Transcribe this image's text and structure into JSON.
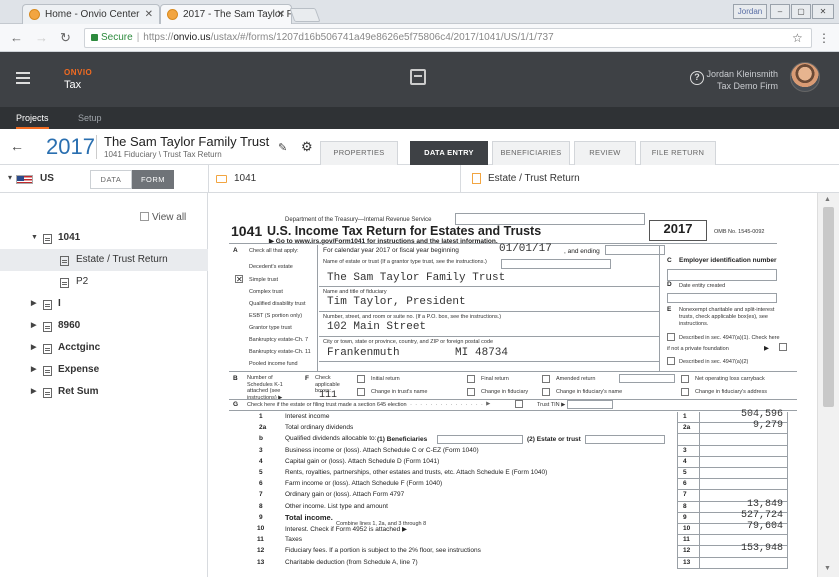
{
  "browser": {
    "tabs": [
      {
        "label": "Home - Onvio Center"
      },
      {
        "label": "2017 - The Sam Taylor F..."
      }
    ],
    "window_user": "Jordan",
    "url": {
      "secure_label": "Secure",
      "scheme": "https://",
      "host": "onvio.us",
      "path": "/ustax/#/forms/1207d16b506741a49e8626e5f75806c4/2017/1041/US/1/1/737"
    }
  },
  "app": {
    "brand": "ONVIO",
    "product": "Tax",
    "user_name": "Jordan Kleinsmith",
    "firm": "Tax Demo Firm",
    "nav": [
      "Projects",
      "Setup"
    ]
  },
  "client": {
    "year": "2017",
    "name": "The Sam Taylor Family Trust",
    "subtitle": "1041 Fiduciary \\ Trust Tax Return",
    "tabs": [
      "PROPERTIES",
      "DATA ENTRY",
      "BENEFICIARIES",
      "REVIEW",
      "FILE RETURN"
    ],
    "active_tab": "DATA ENTRY"
  },
  "toolbar": {
    "jurisdiction": "US",
    "mode_buttons": [
      "DATA",
      "FORM"
    ],
    "active_mode": "FORM",
    "folder": "1041",
    "document": "Estate / Trust Return"
  },
  "sidebar": {
    "view_all": "View all",
    "tree": [
      {
        "label": "1041"
      },
      {
        "label": "Estate / Trust Return"
      },
      {
        "label": "P2"
      },
      {
        "label": "I"
      },
      {
        "label": "8960"
      },
      {
        "label": "Acctginc"
      },
      {
        "label": "Expense"
      },
      {
        "label": "Ret Sum"
      }
    ]
  },
  "form": {
    "dept": "Department of the Treasury—Internal Revenue Service",
    "number": "1041",
    "title": "U.S. Income Tax Return for Estates and Trusts",
    "goto": "▶ Go to www.irs.gov/Form1041 for instructions and the latest information.",
    "year": "2017",
    "omb": "OMB No. 1545-0092",
    "a_label": "Check all that apply:",
    "a_items": [
      "Decedent's estate",
      "Simple trust",
      "Complex trust",
      "Qualified disability trust",
      "ESBT (S portion only)",
      "Grantor type trust",
      "Bankruptcy estate-Ch. 7",
      "Bankruptcy estate-Ch. 11",
      "Pooled income fund"
    ],
    "cal_label": "For calendar year 2017 or fiscal year beginning",
    "begin_date": "01/01/17",
    "and_ending": ", and ending",
    "name_estate_label": "Name of estate or trust (If a grantor type trust, see the instructions.)",
    "trust_name": "The Sam Taylor Family Trust",
    "fiduciary_label": "Name and title of fiduciary",
    "fiduciary": "Tim Taylor, President",
    "street_label": "Number, street, and room or suite no. (If a P.O. box, see the instructions.)",
    "street": "102 Main Street",
    "city_label": "City or town, state or province, country, and ZIP or foreign postal code",
    "city": "Frankenmuth",
    "state": "MI",
    "zip": "48734",
    "c_label": "Employer identification number",
    "d_label": "Date entity created",
    "e_label": "Nonexempt charitable and split-interest trusts, check applicable box(es), see instructions.",
    "e_item1": "Described in sec. 4947(a)(1). Check here",
    "e_item2": "if not a private foundation",
    "e_item3": "Described in sec. 4947(a)(2)",
    "b_label": "Number of Schedules K-1 attached (see instructions) ▶",
    "b_value": "111",
    "f_label": "Check applicable boxes:",
    "f_items": [
      "Initial return",
      "Final return",
      "Amended return",
      "Net operating loss carryback",
      "Change in trust's name",
      "Change in fiduciary",
      "Change in fiduciary's name",
      "Change in fiduciary's address"
    ],
    "g_label": "Check here if the estate or filing trust made a section 645 election",
    "g_tin": "Trust TIN ▶",
    "lines": [
      {
        "no": "1",
        "desc": "Interest income",
        "box": "1",
        "amount": "504,596"
      },
      {
        "no": "2a",
        "desc": "Total ordinary dividends",
        "box": "2a",
        "amount": "9,279"
      },
      {
        "no": "b",
        "desc": "Qualified dividends allocable to:",
        "box": "",
        "amount": ""
      },
      {
        "no": "3",
        "desc": "Business income or (loss). Attach Schedule C or C-EZ (Form 1040)",
        "box": "3",
        "amount": ""
      },
      {
        "no": "4",
        "desc": "Capital gain or (loss). Attach Schedule D (Form 1041)",
        "box": "4",
        "amount": ""
      },
      {
        "no": "5",
        "desc": "Rents, royalties, partnerships, other estates and trusts, etc. Attach Schedule E (Form 1040)",
        "box": "5",
        "amount": ""
      },
      {
        "no": "6",
        "desc": "Farm income or (loss). Attach Schedule F (Form 1040)",
        "box": "6",
        "amount": ""
      },
      {
        "no": "7",
        "desc": "Ordinary gain or (loss). Attach Form 4797",
        "box": "7",
        "amount": ""
      },
      {
        "no": "8",
        "desc": "Other income. List type and amount",
        "box": "8",
        "amount": "13,849"
      },
      {
        "no": "9",
        "desc": "Total income.",
        "box": "9",
        "amount": "527,724"
      },
      {
        "no": "10",
        "desc": "Interest. Check if Form 4952 is attached ▶",
        "box": "10",
        "amount": "79,604"
      },
      {
        "no": "11",
        "desc": "Taxes",
        "box": "11",
        "amount": ""
      },
      {
        "no": "12",
        "desc": "Fiduciary fees. If a portion is subject to the 2% floor, see instructions",
        "box": "12",
        "amount": "153,948"
      },
      {
        "no": "13",
        "desc": "Charitable deduction (from Schedule A, line 7)",
        "box": "13",
        "amount": ""
      }
    ],
    "line2b_beneficiaries": "(1) Beneficiaries",
    "line2b_estate": "(2) Estate or trust",
    "line9_suffix": "Combine lines 1, 2a, and 3 through 8"
  },
  "colors": {
    "header_bg": "#3e4145",
    "accent": "#f26b21",
    "year_blue": "#2a6fb0"
  }
}
